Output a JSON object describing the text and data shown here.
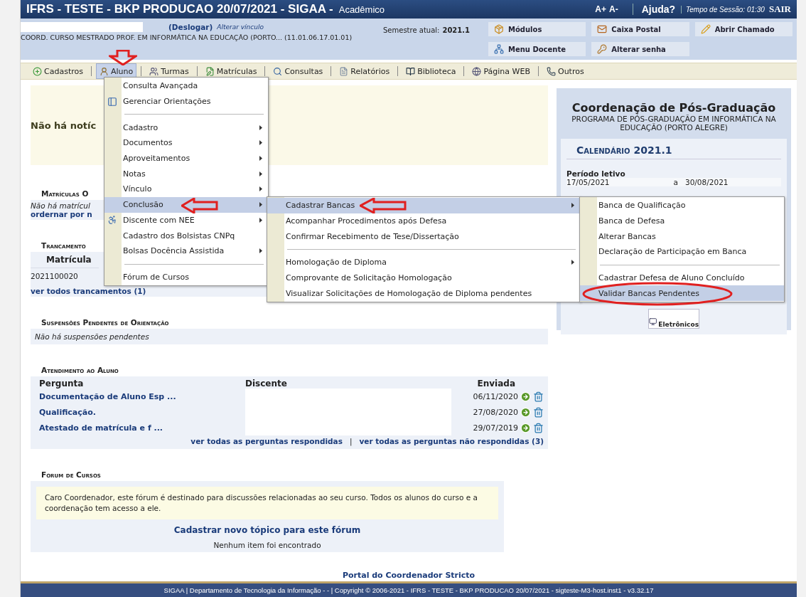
{
  "header": {
    "title": "IFRS - TESTE - BKP PRODUCAO 20/07/2021 - SIGAA -",
    "module": "Acadêmico",
    "font_up": "A+",
    "font_down": "A-",
    "help": "Ajuda?",
    "session": "Tempo de Sessão: 01:30",
    "logout": "SAIR"
  },
  "user": {
    "logout_link": "(Deslogar)",
    "change_link": "Alterar vínculo",
    "unit": "COORD. CURSO MESTRADO PROF. EM INFORMÁTICA NA EDUCAÇÃO (PORTO... (11.01.06.17.01.01)",
    "semester_label": "Semestre atual:",
    "semester": "2021.1"
  },
  "shortcuts": [
    {
      "label": "Módulos"
    },
    {
      "label": "Caixa Postal"
    },
    {
      "label": "Abrir Chamado"
    },
    {
      "label": "Menu Docente"
    },
    {
      "label": "Alterar senha"
    }
  ],
  "menubar": [
    {
      "label": "Cadastros",
      "selected": false
    },
    {
      "label": "Aluno",
      "selected": true
    },
    {
      "label": "Turmas",
      "selected": false
    },
    {
      "label": "Matrículas",
      "selected": false
    },
    {
      "label": "Consultas",
      "selected": false
    },
    {
      "label": "Relatórios",
      "selected": false
    },
    {
      "label": "Biblioteca",
      "selected": false
    },
    {
      "label": "Página WEB",
      "selected": false
    },
    {
      "label": "Outros",
      "selected": false
    }
  ],
  "menu": [
    {
      "kind": "item",
      "label": "Consulta Avançada",
      "icon": false,
      "selected": false
    },
    {
      "kind": "item",
      "label": "Gerenciar Orientações",
      "icon": true,
      "selected": false
    },
    {
      "kind": "separator"
    },
    {
      "kind": "submenu",
      "label": "Cadastro",
      "icon": false,
      "selected": false
    },
    {
      "kind": "submenu",
      "label": "Documentos",
      "icon": false,
      "selected": false
    },
    {
      "kind": "submenu",
      "label": "Aproveitamentos",
      "icon": false,
      "selected": false
    },
    {
      "kind": "submenu",
      "label": "Notas",
      "icon": false,
      "selected": false
    },
    {
      "kind": "submenu",
      "label": "Vínculo",
      "icon": false,
      "selected": false
    },
    {
      "kind": "submenu",
      "label": "Conclusão",
      "icon": false,
      "selected": true
    },
    {
      "kind": "submenu",
      "label": "Discente com NEE",
      "icon": true,
      "selected": false
    },
    {
      "kind": "item",
      "label": "Cadastro dos Bolsistas CNPq",
      "icon": false,
      "selected": false
    },
    {
      "kind": "submenu",
      "label": "Bolsas Docência Assistida",
      "icon": false,
      "selected": false
    },
    {
      "kind": "separator"
    },
    {
      "kind": "item",
      "label": "Fórum de Cursos",
      "icon": false,
      "selected": false
    }
  ],
  "submenu": [
    {
      "kind": "submenu",
      "label": "Cadastrar Bancas",
      "selected": true
    },
    {
      "kind": "item",
      "label": "Acompanhar Procedimentos após Defesa",
      "selected": false
    },
    {
      "kind": "item",
      "label": "Confirmar Recebimento de Tese/Dissertação",
      "selected": false
    },
    {
      "kind": "separator"
    },
    {
      "kind": "submenu",
      "label": "Homologação de Diploma",
      "selected": false
    },
    {
      "kind": "item",
      "label": "Comprovante de Solicitação Homologação",
      "selected": false
    },
    {
      "kind": "item",
      "label": "Visualizar Solicitações de Homologação de Diploma pendentes",
      "selected": false
    }
  ],
  "subsubmenu": [
    {
      "kind": "item",
      "label": "Banca de Qualificação",
      "selected": false
    },
    {
      "kind": "item",
      "label": "Banca de Defesa",
      "selected": false
    },
    {
      "kind": "item",
      "label": "Alterar Bancas",
      "selected": false
    },
    {
      "kind": "item",
      "label": "Declaração de Participação em Banca",
      "selected": false
    },
    {
      "kind": "separator"
    },
    {
      "kind": "item",
      "label": "Cadastrar Defesa de Aluno Concluído",
      "selected": false
    },
    {
      "kind": "item",
      "label": "Validar Bancas Pendentes",
      "selected": true
    }
  ],
  "news": {
    "text": "Não há notíc"
  },
  "matriculas": {
    "title": "Matrículas O",
    "text": "Não há matrícul",
    "link": "ordernar por n"
  },
  "trancamentos": {
    "title": "Trancamento",
    "column": "Matrícula",
    "value": "2021100020",
    "link": "ver todos trancamentos (1)"
  },
  "suspensoes": {
    "title": "Suspensões Pendentes de Orientação",
    "text": "Não há suspensões pendentes"
  },
  "atendimento": {
    "title": "Atendimento ao Aluno",
    "columns": [
      "Pergunta",
      "Discente",
      "Enviada"
    ],
    "rows": [
      {
        "question": "Documentação de Aluno Esp ...",
        "date": "06/11/2020"
      },
      {
        "question": "Qualificação.",
        "date": "27/08/2020"
      },
      {
        "question": "Atestado de matrícula e f ...",
        "date": "29/07/2019"
      }
    ],
    "link_answered": "ver todas as perguntas respondidas",
    "divider": "|",
    "link_unanswered": "ver todas as perguntas não respondidas (3)"
  },
  "forum": {
    "title": "Forum de Cursos",
    "notice": "Caro Coordenador, este fórum é destinado para discussões relacionadas ao seu curso. Todos os alunos do curso e a coordenação tem acesso a ele.",
    "link": "Cadastrar novo tópico para este fórum",
    "empty": "Nenhum item foi encontrado"
  },
  "sidebar": {
    "title": "Coordenação de Pós-Graduação",
    "program": "PROGRAMA DE PÓS-GRADUAÇÃO EM INFORMÁTICA NA EDUCAÇÃO (PORTO ALEGRE)",
    "calendar_title": "Calendário 2021.1",
    "period_label": "Período letivo",
    "start": "17/05/2021",
    "sep": "a",
    "end": "30/08/2021",
    "memo_label": "Eletrônicos"
  },
  "footer": {
    "portal": "Portal do Coordenador Stricto",
    "text": "SIGAA | Departamento de Tecnologia da Informação - - | Copyright © 2006-2021 - IFRS - TESTE - BKP PRODUCAO 20/07/2021 - sigteste-M3-host.inst1 - v3.32.17"
  }
}
